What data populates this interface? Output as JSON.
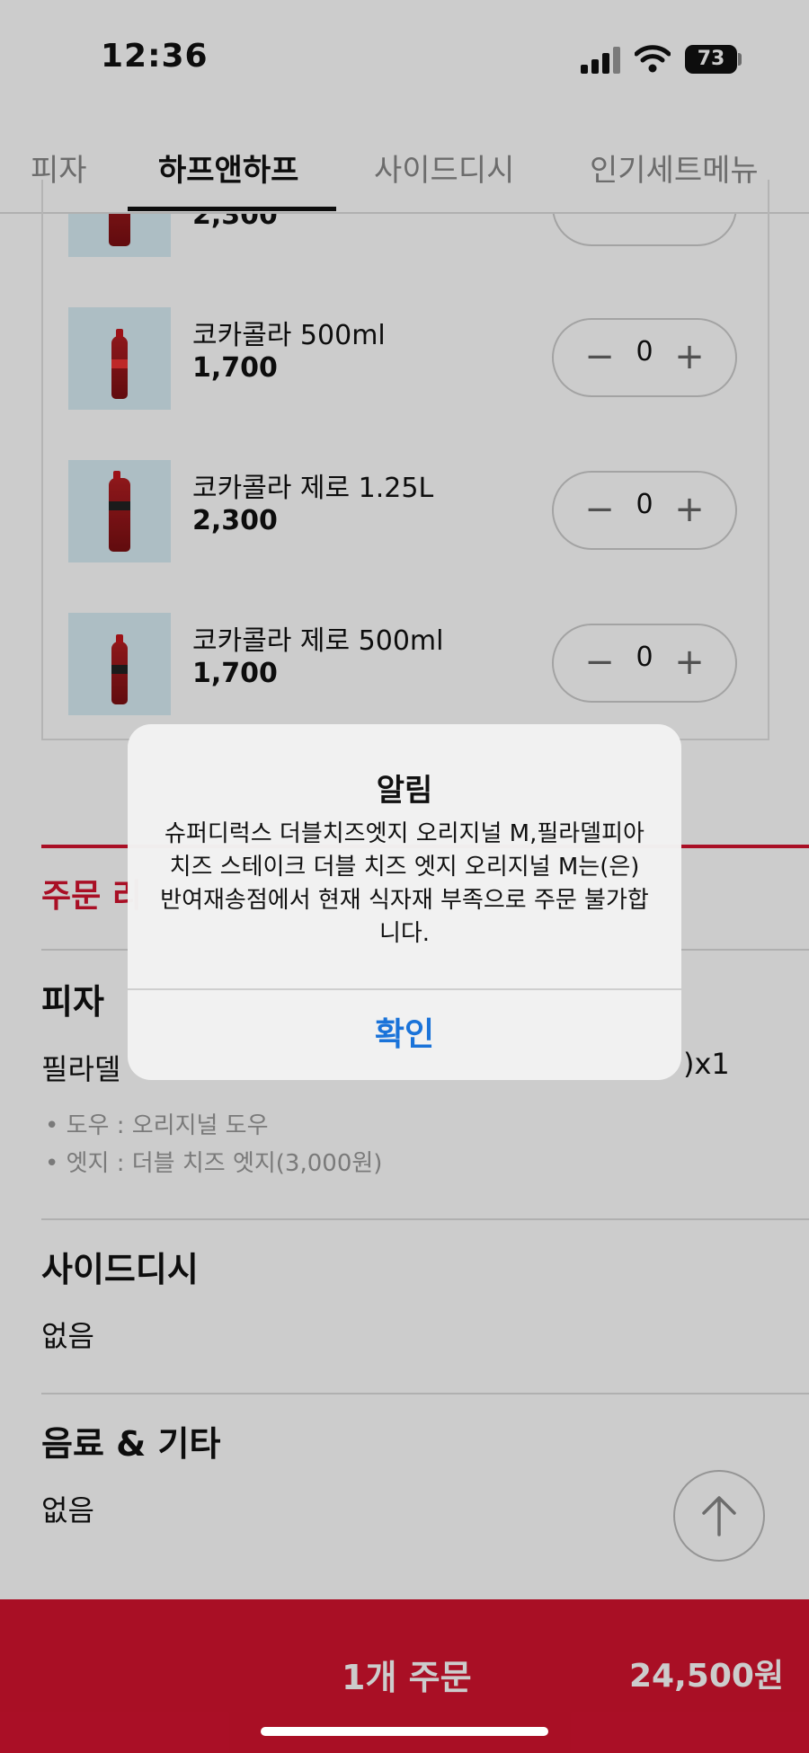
{
  "status_bar": {
    "time": "12:36",
    "battery": "73"
  },
  "tabs": [
    {
      "label": "피자"
    },
    {
      "label": "하프앤하프"
    },
    {
      "label": "사이드디시"
    },
    {
      "label": "인기세트메뉴"
    }
  ],
  "products": [
    {
      "name": "",
      "price": "2,300",
      "qty": "0"
    },
    {
      "name": "코카콜라 500ml",
      "price": "1,700",
      "qty": "0"
    },
    {
      "name": "코카콜라 제로 1.25L",
      "price": "2,300",
      "qty": "0"
    },
    {
      "name": "코카콜라 제로 500ml",
      "price": "1,700",
      "qty": "0"
    }
  ],
  "order_summary": {
    "title": "주문 리",
    "pizza_section": {
      "title": "피자",
      "item": "필라델",
      "qty_suffix": ")x1",
      "options": [
        "• 도우 : 오리지널 도우",
        "• 엣지 : 더블 치즈 엣지(3,000원)"
      ]
    },
    "side_section": {
      "title": "사이드디시",
      "value": "없음"
    },
    "drink_section": {
      "title": "음료 & 기타",
      "value": "없음"
    }
  },
  "order_bar": {
    "count_label": "1개 주문",
    "total": "24,500원"
  },
  "alert": {
    "title": "알림",
    "message": "슈퍼디럭스 더블치즈엣지 오리지널 M,필라델피아 치즈 스테이크 더블 치즈 엣지 오리지널 M는(은) 반여재송점에서 현재 식자재 부족으로 주문 불가합니다.",
    "confirm_label": "확인"
  },
  "colors": {
    "brand_red": "#d4132f",
    "alert_button_blue": "#1a73d9"
  }
}
